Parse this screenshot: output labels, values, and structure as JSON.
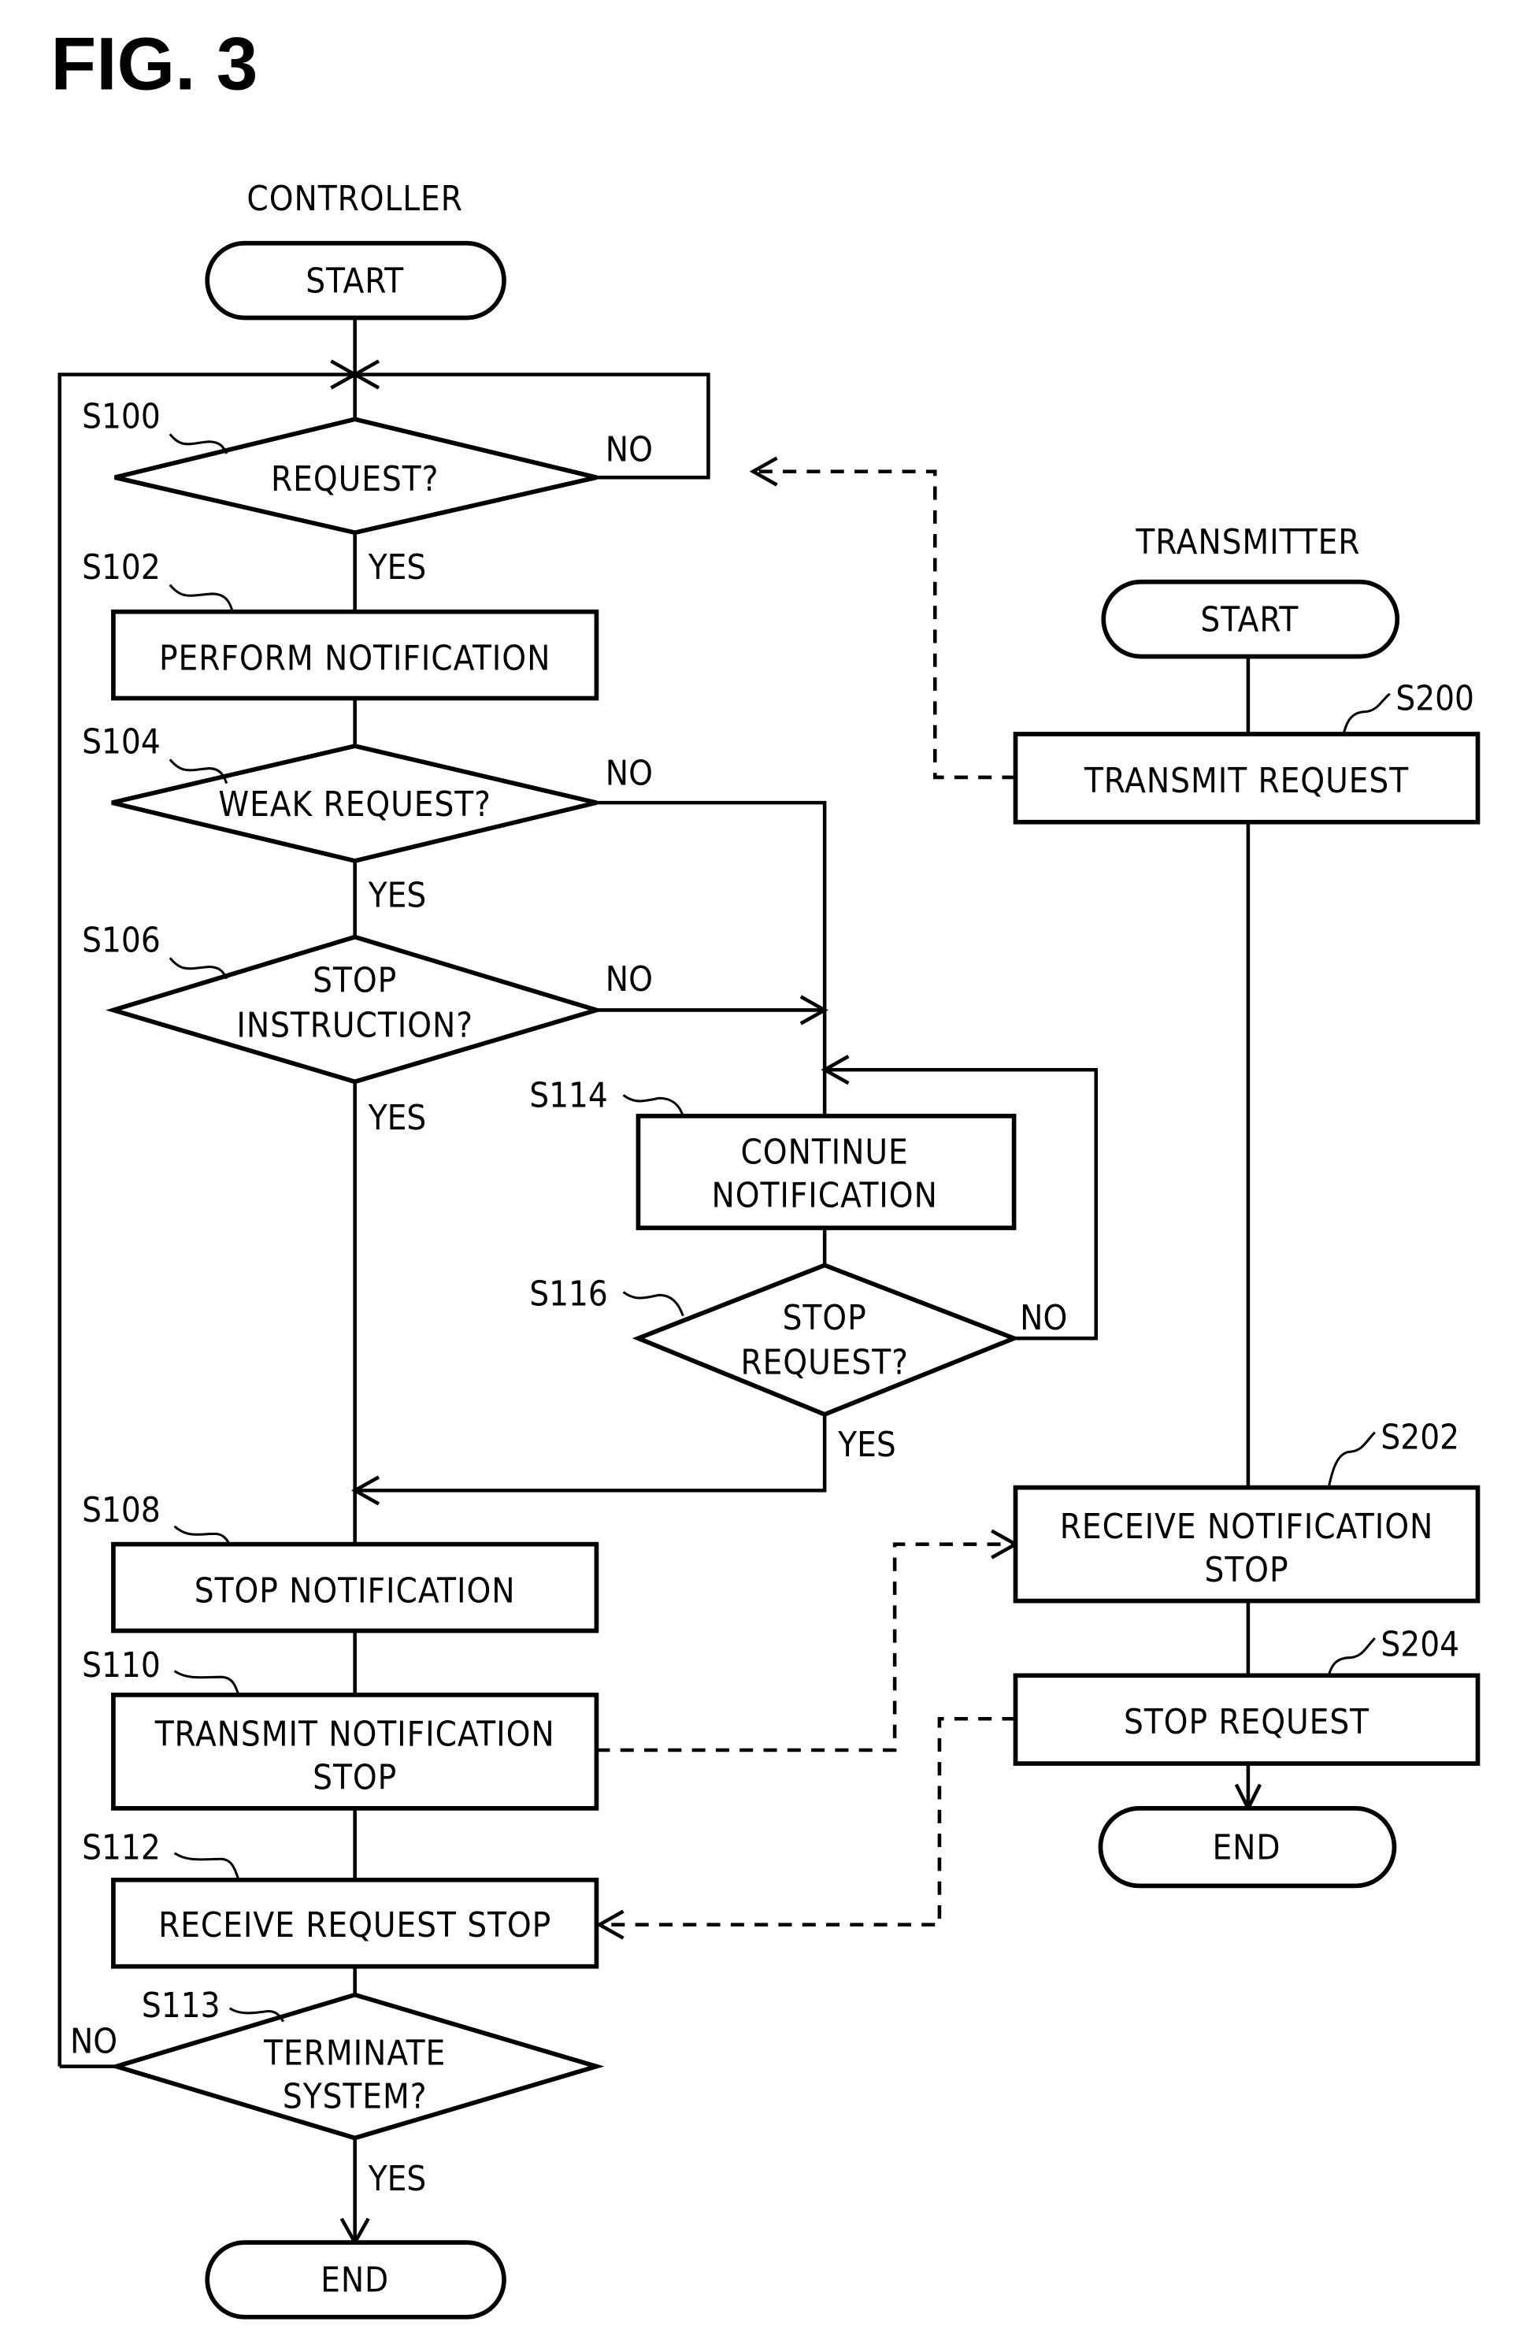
{
  "figure": {
    "title": "FIG. 3"
  },
  "controller": {
    "heading": "CONTROLLER",
    "start": "START",
    "end": "END",
    "steps": {
      "s100": {
        "id": "S100",
        "type": "decision",
        "lines": [
          "REQUEST?"
        ]
      },
      "s102": {
        "id": "S102",
        "type": "process",
        "lines": [
          "PERFORM NOTIFICATION"
        ]
      },
      "s104": {
        "id": "S104",
        "type": "decision",
        "lines": [
          "WEAK REQUEST?"
        ]
      },
      "s106": {
        "id": "S106",
        "type": "decision",
        "lines": [
          "STOP",
          "INSTRUCTION?"
        ]
      },
      "s108": {
        "id": "S108",
        "type": "process",
        "lines": [
          "STOP NOTIFICATION"
        ]
      },
      "s110": {
        "id": "S110",
        "type": "process",
        "lines": [
          "TRANSMIT NOTIFICATION",
          "STOP"
        ]
      },
      "s112": {
        "id": "S112",
        "type": "process",
        "lines": [
          "RECEIVE REQUEST STOP"
        ]
      },
      "s113": {
        "id": "S113",
        "type": "decision",
        "lines": [
          "TERMINATE",
          "SYSTEM?"
        ]
      },
      "s114": {
        "id": "S114",
        "type": "process",
        "lines": [
          "CONTINUE",
          "NOTIFICATION"
        ]
      },
      "s116": {
        "id": "S116",
        "type": "decision",
        "lines": [
          "STOP",
          "REQUEST?"
        ]
      }
    }
  },
  "transmitter": {
    "heading": "TRANSMITTER",
    "start": "START",
    "end": "END",
    "steps": {
      "s200": {
        "id": "S200",
        "type": "process",
        "lines": [
          "TRANSMIT REQUEST"
        ]
      },
      "s202": {
        "id": "S202",
        "type": "process",
        "lines": [
          "RECEIVE NOTIFICATION",
          "STOP"
        ]
      },
      "s204": {
        "id": "S204",
        "type": "process",
        "lines": [
          "STOP REQUEST"
        ]
      }
    }
  },
  "branch_labels": {
    "yes": "YES",
    "no": "NO"
  },
  "flows": [
    {
      "from": "START",
      "to": "S100"
    },
    {
      "from": "S100",
      "to": "S100",
      "label": "NO"
    },
    {
      "from": "S100",
      "to": "S102",
      "label": "YES"
    },
    {
      "from": "S102",
      "to": "S104"
    },
    {
      "from": "S104",
      "to": "S114",
      "label": "NO"
    },
    {
      "from": "S104",
      "to": "S106",
      "label": "YES"
    },
    {
      "from": "S106",
      "to": "S114",
      "label": "NO"
    },
    {
      "from": "S106",
      "to": "S108",
      "label": "YES"
    },
    {
      "from": "S114",
      "to": "S116"
    },
    {
      "from": "S116",
      "to": "S114",
      "label": "NO"
    },
    {
      "from": "S116",
      "to": "S108",
      "label": "YES"
    },
    {
      "from": "S108",
      "to": "S110"
    },
    {
      "from": "S110",
      "to": "S112"
    },
    {
      "from": "S112",
      "to": "S113"
    },
    {
      "from": "S113",
      "to": "S100",
      "label": "NO"
    },
    {
      "from": "S113",
      "to": "END",
      "label": "YES"
    },
    {
      "from": "START (TRANSMITTER)",
      "to": "S200"
    },
    {
      "from": "S200",
      "to": "S202"
    },
    {
      "from": "S202",
      "to": "S204"
    },
    {
      "from": "S204",
      "to": "END (TRANSMITTER)"
    },
    {
      "from": "S200",
      "to": "S100",
      "style": "dashed"
    },
    {
      "from": "S110",
      "to": "S202",
      "style": "dashed"
    },
    {
      "from": "S204",
      "to": "S112",
      "style": "dashed"
    }
  ]
}
